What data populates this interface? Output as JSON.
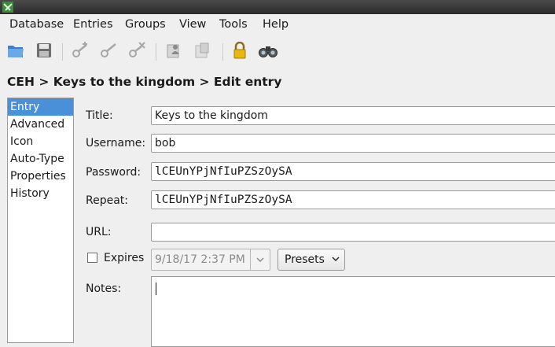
{
  "menu": [
    "Database",
    "Entries",
    "Groups",
    "View",
    "Tools",
    "Help"
  ],
  "toolbar": {
    "icons": [
      "open-database-icon",
      "save-database-icon",
      "add-entry-icon",
      "edit-entry-icon",
      "delete-entry-icon",
      "copy-username-icon",
      "copy-password-icon",
      "lock-database-icon",
      "search-icon"
    ]
  },
  "breadcrumb": "CEH > Keys to the kingdom > Edit entry",
  "sidebar": {
    "items": [
      {
        "label": "Entry"
      },
      {
        "label": "Advanced"
      },
      {
        "label": "Icon"
      },
      {
        "label": "Auto-Type"
      },
      {
        "label": "Properties"
      },
      {
        "label": "History"
      }
    ],
    "active": "Entry"
  },
  "form": {
    "title_label": "Title:",
    "title_value": "Keys to the kingdom",
    "username_label": "Username:",
    "username_value": "bob",
    "password_label": "Password:",
    "password_value": "lCEUnYPjNfIuPZSzOySA",
    "repeat_label": "Repeat:",
    "repeat_value": "lCEUnYPjNfIuPZSzOySA",
    "url_label": "URL:",
    "url_value": "",
    "expires_label": "Expires",
    "expires_checked": false,
    "expires_value": "9/18/17 2:37 PM",
    "presets_label": "Presets",
    "notes_label": "Notes:",
    "notes_value": ""
  },
  "colors": {
    "selection": "#4a90d9",
    "titlebar": "#2b2b2b"
  }
}
